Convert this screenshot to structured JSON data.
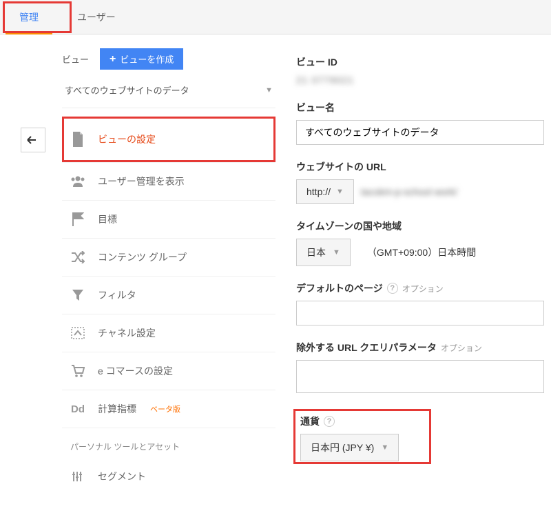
{
  "tabs": {
    "admin": "管理",
    "user": "ユーザー"
  },
  "back_arrow": "↩",
  "view_header": {
    "label": "ビュー",
    "create_btn": "ビューを作成"
  },
  "view_select": "すべてのウェブサイトのデータ",
  "nav": {
    "settings": "ビューの設定",
    "users": "ユーザー管理を表示",
    "goals": "目標",
    "content_groups": "コンテンツ グループ",
    "filters": "フィルタ",
    "channel": "チャネル設定",
    "ecommerce": "e コマースの設定",
    "calc": "計算指標",
    "calc_beta": "ベータ版"
  },
  "section": {
    "personal": "パーソナル ツールとアセット"
  },
  "nav2": {
    "segments": "セグメント"
  },
  "fields": {
    "view_id_label": "ビュー ID",
    "view_id_value": "21 0779021",
    "view_name_label": "ビュー名",
    "view_name_value": "すべてのウェブサイトのデータ",
    "url_label": "ウェブサイトの URL",
    "protocol": "http://",
    "url_value": "tacokm-p-school work/",
    "tz_label": "タイムゾーンの国や地域",
    "tz_country": "日本",
    "tz_display": "（GMT+09:00）日本時間",
    "default_page_label": "デフォルトのページ",
    "exclude_url_label": "除外する URL クエリパラメータ",
    "optional": "オプション",
    "currency_label": "通貨",
    "currency_value": "日本円 (JPY ¥)"
  }
}
